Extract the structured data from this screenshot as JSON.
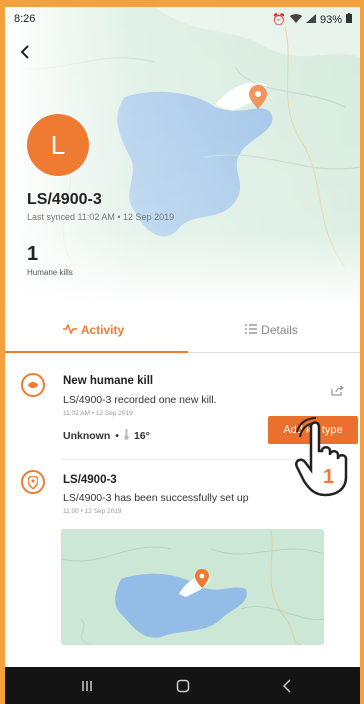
{
  "status_bar": {
    "time": "8:26",
    "battery": "93%"
  },
  "device": {
    "avatar_letter": "L",
    "title": "LS/4900-3",
    "last_synced": "Last synced 11:02 AM • 12 Sep 2019",
    "humane_kills_count": "1",
    "humane_kills_label": "Humane kills"
  },
  "tabs": [
    {
      "label": "Activity",
      "icon": "activity-icon",
      "active": true
    },
    {
      "label": "Details",
      "icon": "list-icon",
      "active": false
    }
  ],
  "events": [
    {
      "title": "New humane kill",
      "description": "LS/4900-3 recorded one new kill.",
      "time": "11:02 AM • 12 Sep 2019",
      "kill_type": "Unknown",
      "separator": "•",
      "temperature": "16°",
      "action_label": "Add kill type"
    },
    {
      "title": "LS/4900-3",
      "description": "LS/4900-3 has been successfully set up",
      "time": "11:00 • 12 Sep 2019"
    }
  ],
  "tap_marker": "1",
  "colors": {
    "accent": "#ef7b33",
    "map_land": "#cfe6d8",
    "map_water": "#8fb9e4"
  }
}
